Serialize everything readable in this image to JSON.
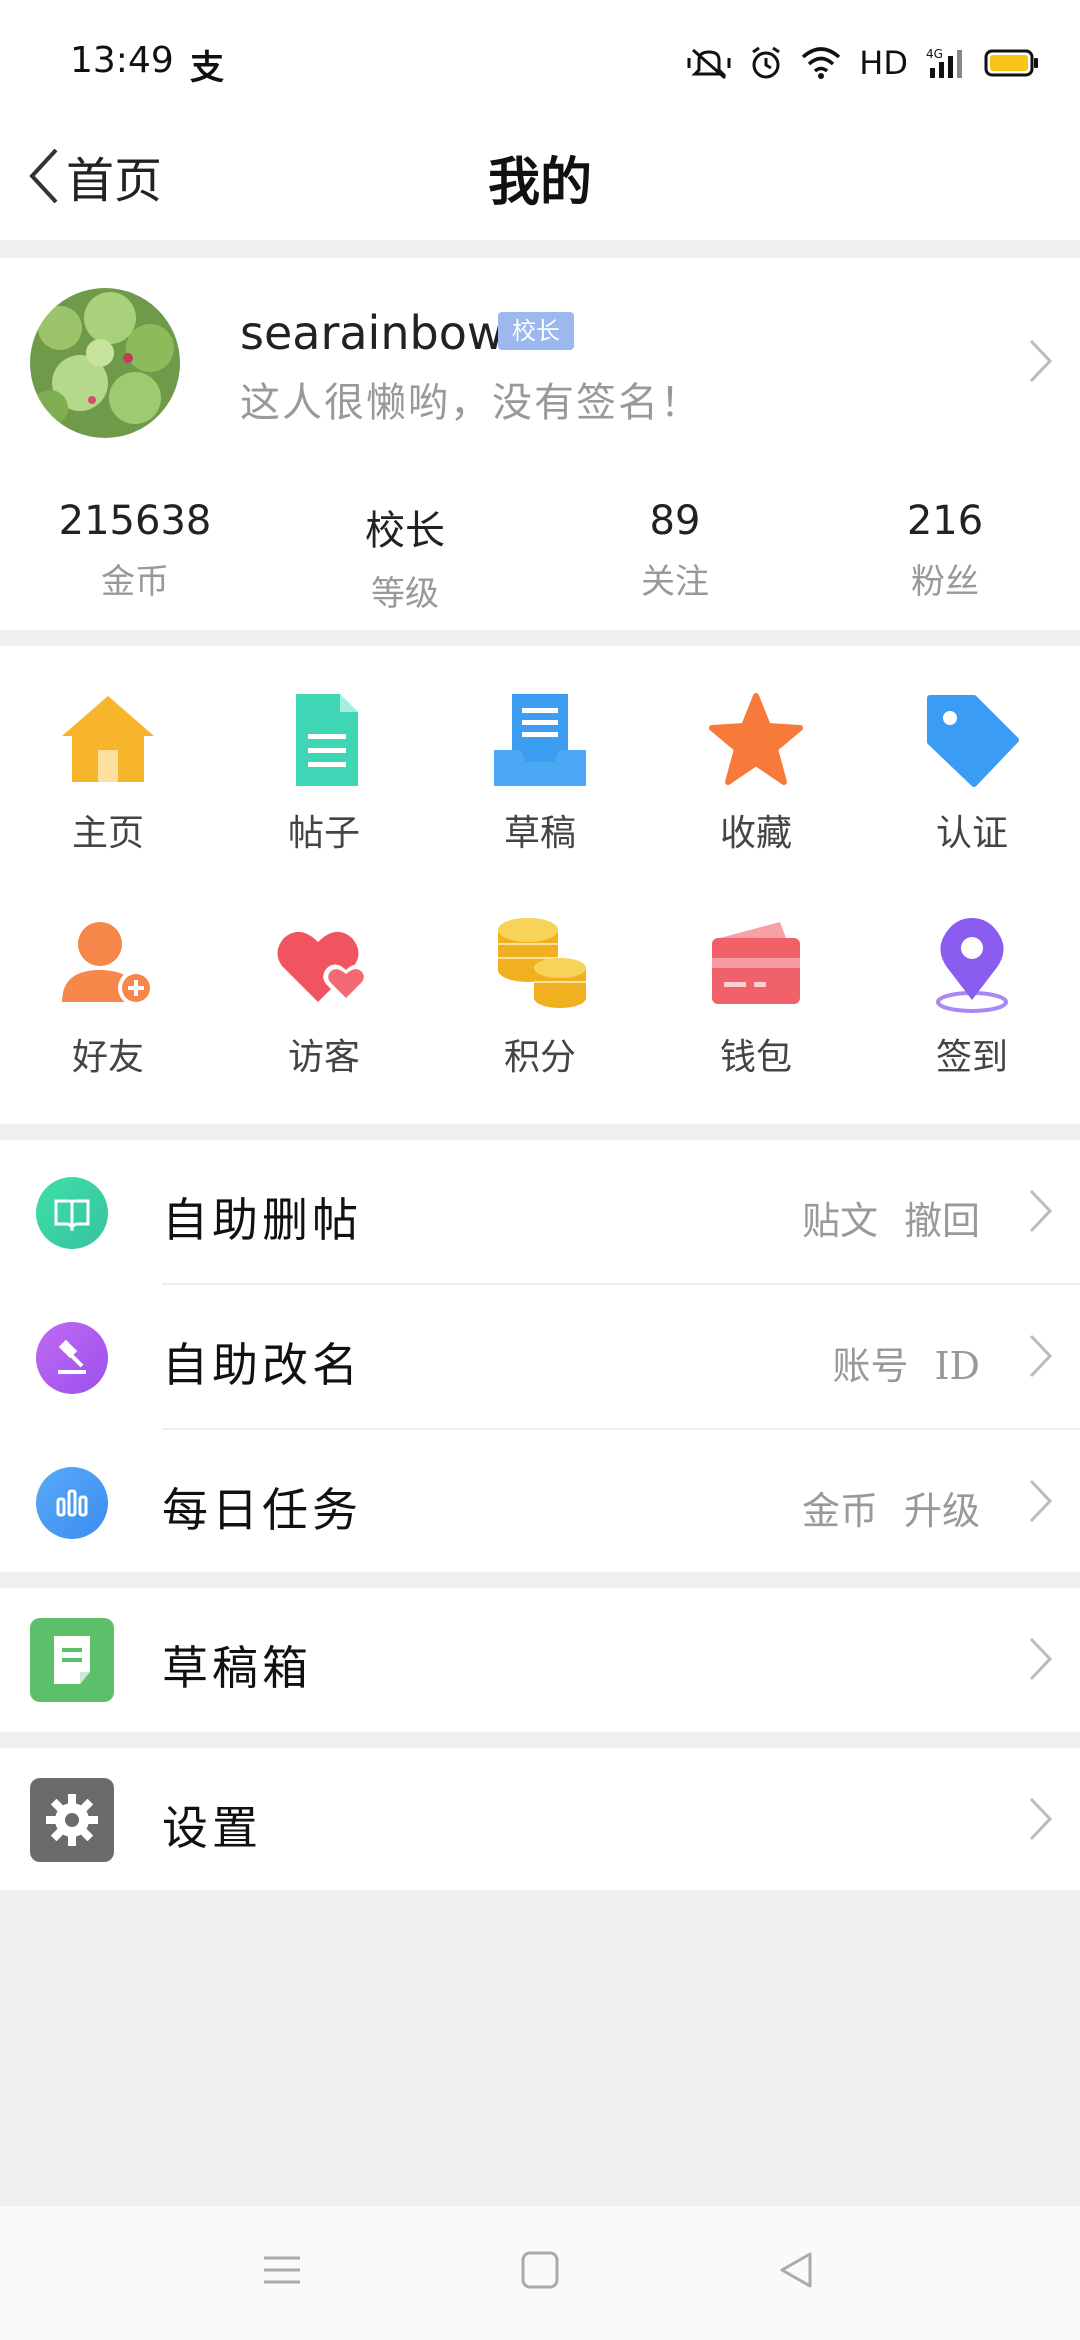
{
  "status_bar": {
    "time": "13:49",
    "app_glyph": "支",
    "network_label": "HD",
    "signal_label": "4G",
    "icons": [
      "mute-icon",
      "alarm-icon",
      "wifi-icon",
      "signal-icon",
      "battery-icon"
    ]
  },
  "nav": {
    "back_label": "首页",
    "title": "我的"
  },
  "profile": {
    "username": "searainbow",
    "badge": "校长",
    "signature": "这人很懒哟，没有签名！",
    "stats": [
      {
        "value": "215638",
        "label": "金币"
      },
      {
        "value": "校长",
        "label": "等级"
      },
      {
        "value": "89",
        "label": "关注"
      },
      {
        "value": "216",
        "label": "粉丝"
      }
    ]
  },
  "grid": {
    "items": [
      {
        "label": "主页",
        "icon": "home-icon",
        "color": "#f7b52c"
      },
      {
        "label": "帖子",
        "icon": "document-icon",
        "color": "#3ed6b5"
      },
      {
        "label": "草稿",
        "icon": "draft-tray-icon",
        "color": "#3b9ef0"
      },
      {
        "label": "收藏",
        "icon": "star-icon",
        "color": "#f77a3a"
      },
      {
        "label": "认证",
        "icon": "tag-icon",
        "color": "#3a9cf5"
      },
      {
        "label": "好友",
        "icon": "add-friend-icon",
        "color": "#f7874a"
      },
      {
        "label": "访客",
        "icon": "hearts-icon",
        "color": "#f0545f"
      },
      {
        "label": "积分",
        "icon": "coins-icon",
        "color": "#f5c431"
      },
      {
        "label": "钱包",
        "icon": "wallet-icon",
        "color": "#f0616a"
      },
      {
        "label": "签到",
        "icon": "location-pin-icon",
        "color": "#8a5cf0"
      }
    ]
  },
  "list1": {
    "rows": [
      {
        "label": "自助删帖",
        "right": [
          "贴文",
          "撤回"
        ],
        "icon": "book-icon",
        "color": "#3dd1a0"
      },
      {
        "label": "自助改名",
        "right": [
          "账号",
          "ID"
        ],
        "icon": "hammer-icon",
        "color": "#b35cf0"
      },
      {
        "label": "每日任务",
        "right": [
          "金币",
          "升级"
        ],
        "icon": "bar-chart-icon",
        "color": "#4a9cf5"
      }
    ]
  },
  "list2": {
    "label": "草稿箱",
    "icon": "note-icon",
    "color": "#5cbf6a"
  },
  "list3": {
    "label": "设置",
    "icon": "gear-icon",
    "color": "#6b6b6b"
  },
  "system_nav": [
    "menu-icon",
    "home-square-icon",
    "back-triangle-icon"
  ]
}
